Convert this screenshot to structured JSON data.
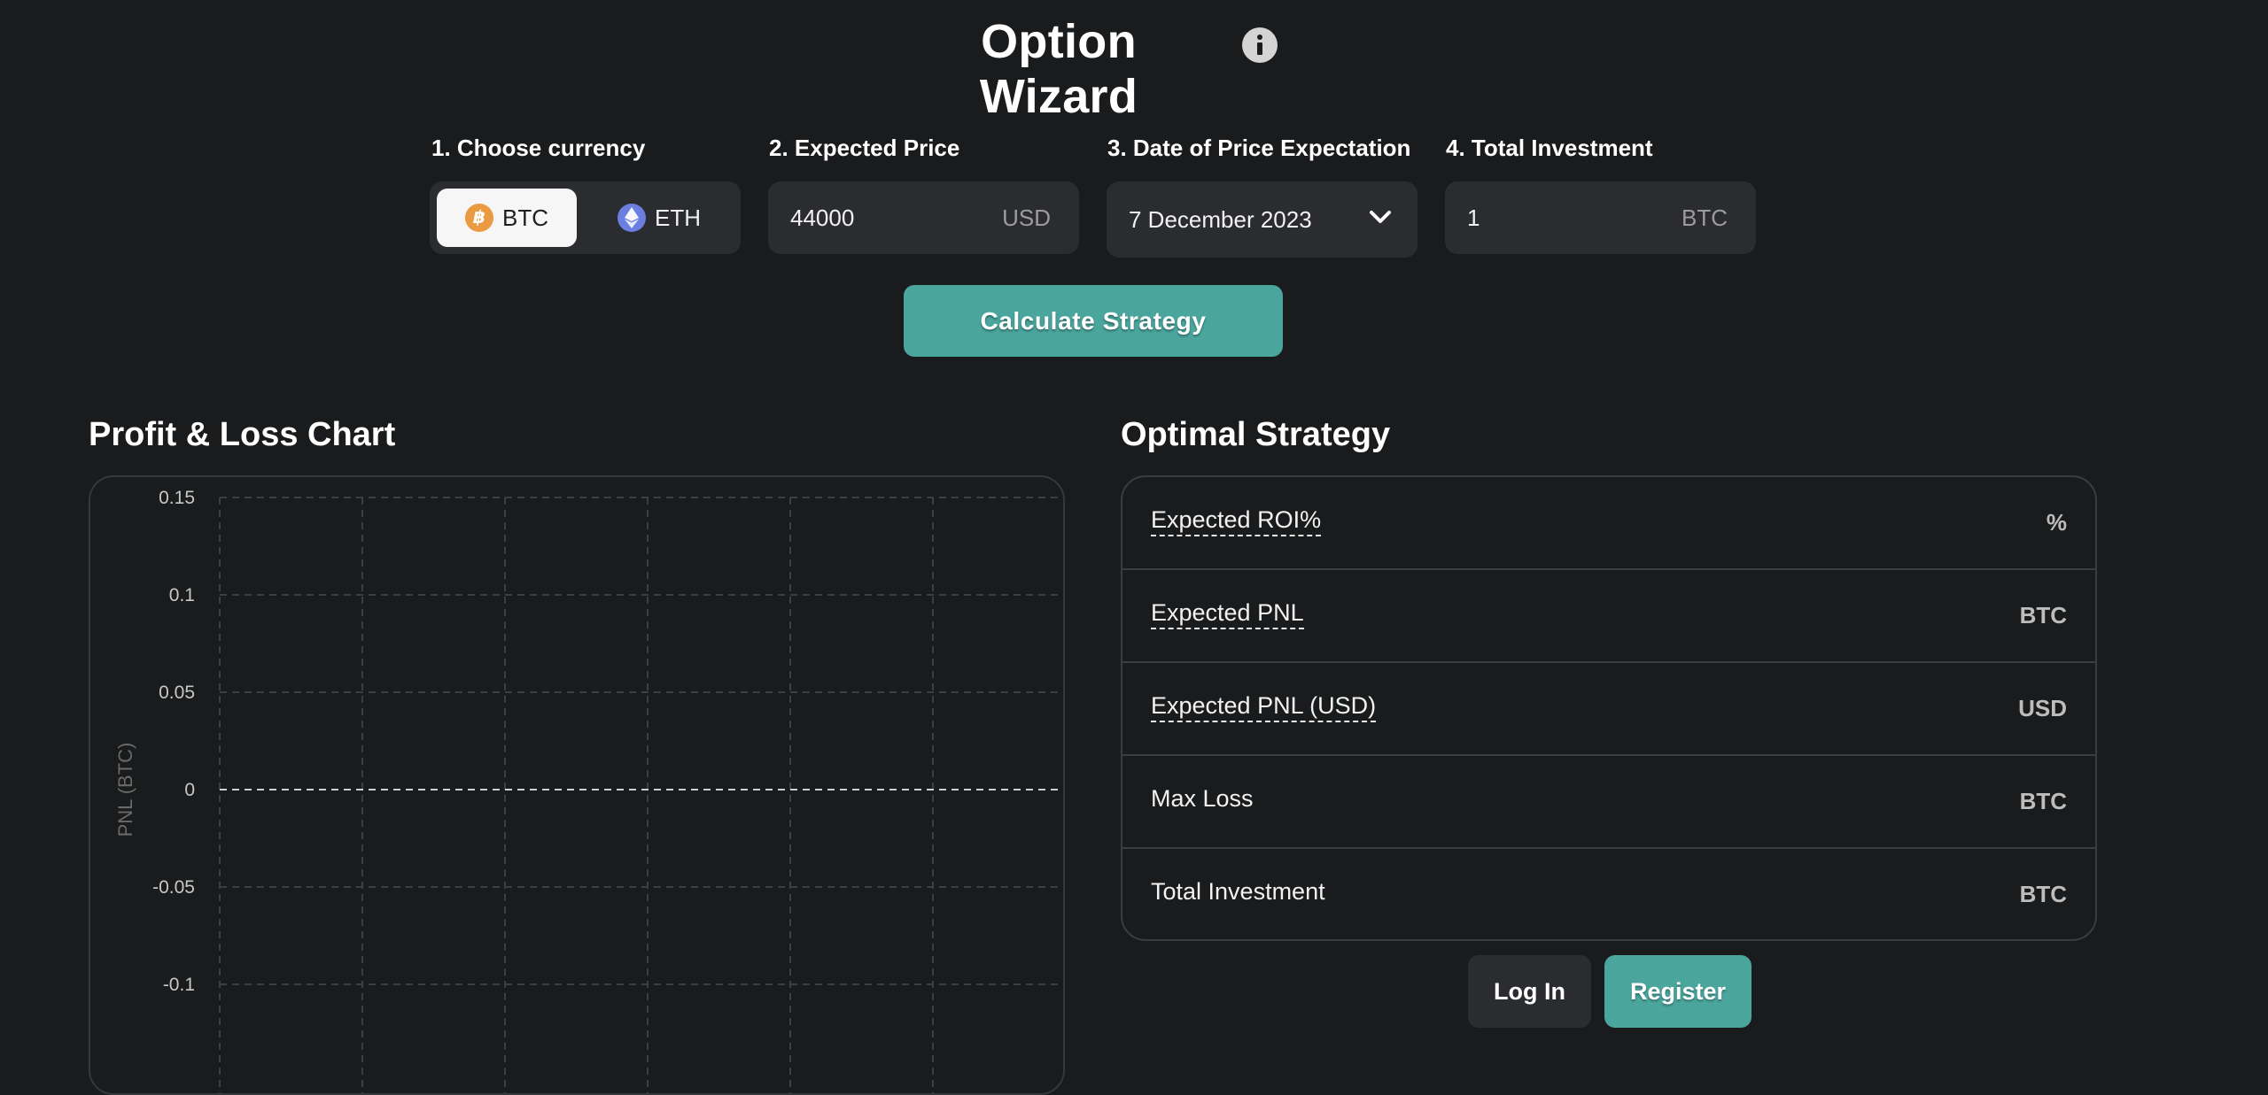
{
  "header": {
    "title": "Option Wizard",
    "info_icon": "info-icon"
  },
  "form": {
    "currency": {
      "label": "1. Choose currency",
      "options": [
        {
          "label": "BTC",
          "icon": "bitcoin-icon",
          "selected": true
        },
        {
          "label": "ETH",
          "icon": "ethereum-icon",
          "selected": false
        }
      ]
    },
    "expected_price": {
      "label": "2. Expected Price",
      "value": "44000",
      "unit": "USD"
    },
    "date": {
      "label": "3. Date of Price Expectation",
      "value": "7 December 2023",
      "icon": "chevron-down-icon"
    },
    "investment": {
      "label": "4. Total Investment",
      "value": "1",
      "unit": "BTC"
    },
    "calculate_label": "Calculate Strategy"
  },
  "chart_section": {
    "title": "Profit & Loss Chart"
  },
  "chart_data": {
    "type": "line",
    "title": "Profit & Loss Chart",
    "xlabel": "",
    "ylabel": "PNL (BTC)",
    "yticks": [
      0.15,
      0.1,
      0.05,
      0,
      -0.05,
      -0.1
    ],
    "ytick_labels": [
      "0.15",
      "0.1",
      "0.05",
      "0",
      "-0.05",
      "-0.1"
    ],
    "ylim": [
      -0.15,
      0.15
    ],
    "x_gridlines": 7,
    "series": [],
    "grid": true,
    "zero_line": true
  },
  "strategy": {
    "title": "Optimal Strategy",
    "rows": [
      {
        "label": "Expected ROI%",
        "unit": "%",
        "tooltip": true
      },
      {
        "label": "Expected PNL",
        "unit": "BTC",
        "tooltip": true
      },
      {
        "label": "Expected PNL (USD)",
        "unit": "USD",
        "tooltip": true
      },
      {
        "label": "Max Loss",
        "unit": "BTC",
        "tooltip": false
      },
      {
        "label": "Total Investment",
        "unit": "BTC",
        "tooltip": false
      }
    ]
  },
  "auth": {
    "login_label": "Log In",
    "register_label": "Register"
  },
  "colors": {
    "background": "#1a1b1c",
    "accent": "#4aa59d",
    "field_bg": "#2b2c2f",
    "btc": "#ea9a41",
    "eth": "#6c7ee0"
  }
}
